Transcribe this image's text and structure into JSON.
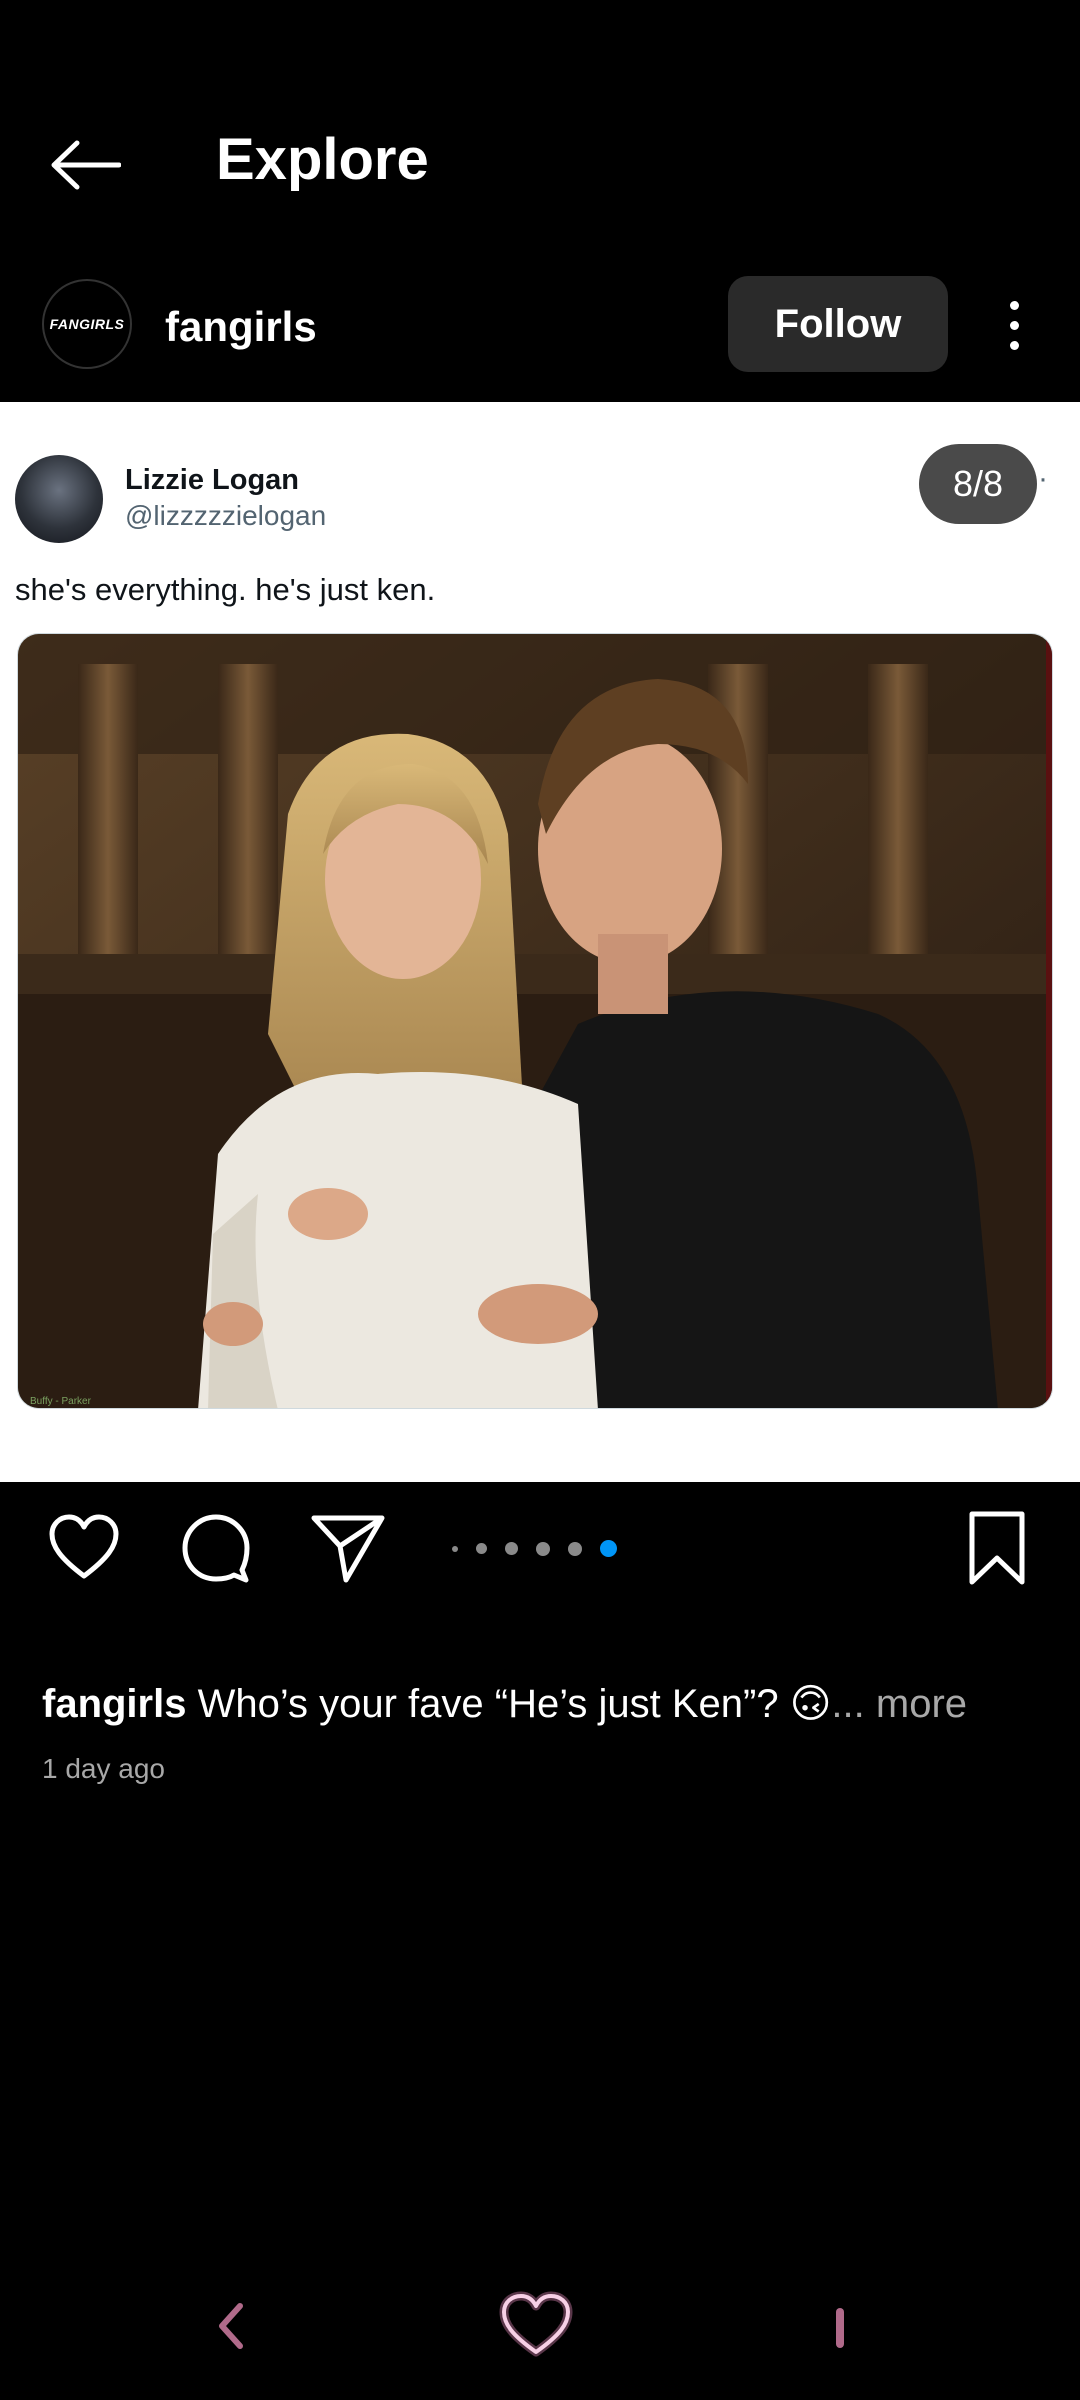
{
  "header": {
    "title": "Explore"
  },
  "account": {
    "avatar_text": "FANGIRLS",
    "name": "fangirls",
    "follow_label": "Follow"
  },
  "post": {
    "counter": "8/8",
    "author_name": "Lizzie Logan",
    "author_handle": "@lizzzzzielogan",
    "text": "she's everything. he's just ken.",
    "photo_watermark": "Buffy - Parker",
    "carousel": {
      "dot_count": 6,
      "active_index": 5
    }
  },
  "caption": {
    "user": "fangirls",
    "text": "Who’s your fave “He’s just Ken”? 🙃",
    "more": "... more",
    "time": "1 day ago"
  },
  "icons": {
    "back": "arrow-left-icon",
    "more": "vertical-dots-icon",
    "like": "heart-icon",
    "comment": "comment-bubble-icon",
    "share": "send-icon",
    "save": "bookmark-icon",
    "nav_back": "chevron-left-icon",
    "nav_home": "heart-glow-icon"
  },
  "colors": {
    "accent_dot": "#0095f6",
    "card_bg": "#ffffff",
    "follow_bg": "#2a2a2a",
    "nav_accent": "#b06a8a"
  }
}
